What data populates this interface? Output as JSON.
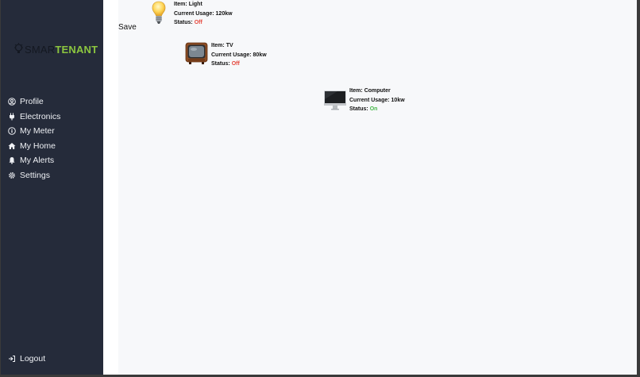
{
  "brand": {
    "part1": "SMAR",
    "part2": "TENANT",
    "accent": "#8cc63f"
  },
  "sidebar": {
    "items": [
      {
        "label": "Profile",
        "icon": "user-circle-icon"
      },
      {
        "label": "Electronics",
        "icon": "plug-icon"
      },
      {
        "label": "My Meter",
        "icon": "gauge-icon"
      },
      {
        "label": "My Home",
        "icon": "home-icon"
      },
      {
        "label": "My Alerts",
        "icon": "bell-icon"
      },
      {
        "label": "Settings",
        "icon": "gear-icon"
      }
    ],
    "logout": "Logout"
  },
  "toolbar": {
    "save_label": "Save"
  },
  "devices": [
    {
      "icon": "light-bulb-icon",
      "item_label": "Item:",
      "item": "Light",
      "usage_label": "Current Usage:",
      "usage": "120kw",
      "status_label": "Status:",
      "status": "Off"
    },
    {
      "icon": "tv-icon",
      "item_label": "Item:",
      "item": "TV",
      "usage_label": "Current Usage:",
      "usage": "80kw",
      "status_label": "Status:",
      "status": "Off"
    },
    {
      "icon": "computer-icon",
      "item_label": "Item:",
      "item": "Computer",
      "usage_label": "Current Usage:",
      "usage": "10kw",
      "status_label": "Status:",
      "status": "On"
    }
  ],
  "colors": {
    "sidebar_bg": "#252b3a",
    "status_off": "#e5483d",
    "status_on": "#47b84a",
    "main_bg": "#f7f8fa"
  }
}
